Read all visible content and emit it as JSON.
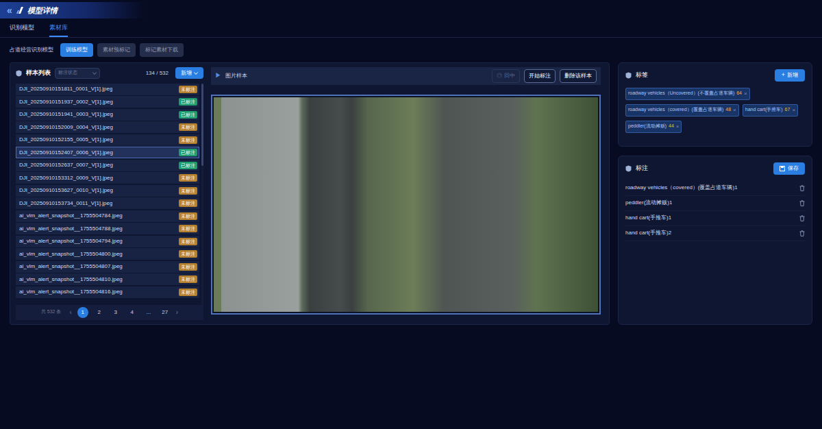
{
  "header": {
    "back_icon": "«",
    "title": "模型详情"
  },
  "tabs": [
    {
      "label": "识别模型",
      "selected": false
    },
    {
      "label": "素材库",
      "selected": true
    }
  ],
  "toolbar": {
    "model_name": "占道经营识别模型",
    "buttons": [
      {
        "label": "训练模型",
        "selected": true
      },
      {
        "label": "素材预标记",
        "selected": false
      },
      {
        "label": "标记素材下载",
        "selected": false
      }
    ]
  },
  "sample_list": {
    "title": "样本列表",
    "filter": {
      "placeholder": "标注状态"
    },
    "count": "134 / 532",
    "add_button": "新增",
    "rows": [
      {
        "name": "DJI_20250910151811_0001_V[1].jpeg",
        "status": "未标注",
        "labeled": false,
        "selected": false
      },
      {
        "name": "DJI_20250910151937_0002_V[1].jpeg",
        "status": "已标注",
        "labeled": true,
        "selected": false
      },
      {
        "name": "DJI_20250910151941_0003_V[1].jpeg",
        "status": "已标注",
        "labeled": true,
        "selected": false
      },
      {
        "name": "DJI_20250910152009_0004_V[1].jpeg",
        "status": "未标注",
        "labeled": false,
        "selected": false
      },
      {
        "name": "DJI_20250910152155_0005_V[1].jpeg",
        "status": "未标注",
        "labeled": false,
        "selected": false
      },
      {
        "name": "DJI_20250910152407_0006_V[1].jpeg",
        "status": "已标注",
        "labeled": true,
        "selected": true
      },
      {
        "name": "DJI_20250910152637_0007_V[1].jpeg",
        "status": "已标注",
        "labeled": true,
        "selected": false
      },
      {
        "name": "DJI_20250910153312_0009_V[1].jpeg",
        "status": "未标注",
        "labeled": false,
        "selected": false
      },
      {
        "name": "DJI_20250910153627_0010_V[1].jpeg",
        "status": "未标注",
        "labeled": false,
        "selected": false
      },
      {
        "name": "DJI_20250910153734_0011_V[1].jpeg",
        "status": "未标注",
        "labeled": false,
        "selected": false
      },
      {
        "name": "ai_vlm_alert_snapshot__1755504784.jpeg",
        "status": "未标注",
        "labeled": false,
        "selected": false
      },
      {
        "name": "ai_vlm_alert_snapshot__1755504788.jpeg",
        "status": "未标注",
        "labeled": false,
        "selected": false
      },
      {
        "name": "ai_vlm_alert_snapshot__1755504794.jpeg",
        "status": "未标注",
        "labeled": false,
        "selected": false
      },
      {
        "name": "ai_vlm_alert_snapshot__1755504800.jpeg",
        "status": "未标注",
        "labeled": false,
        "selected": false
      },
      {
        "name": "ai_vlm_alert_snapshot__1755504807.jpeg",
        "status": "未标注",
        "labeled": false,
        "selected": false
      },
      {
        "name": "ai_vlm_alert_snapshot__1755504810.jpeg",
        "status": "未标注",
        "labeled": false,
        "selected": false
      },
      {
        "name": "ai_vlm_alert_snapshot__1755504816.jpeg",
        "status": "未标注",
        "labeled": false,
        "selected": false
      }
    ],
    "pagination": {
      "total": "共 532 条",
      "prev": "‹",
      "next": "›",
      "pages": [
        {
          "label": "1",
          "selected": true
        },
        {
          "label": "2",
          "selected": false
        },
        {
          "label": "3",
          "selected": false
        },
        {
          "label": "4",
          "selected": false
        },
        {
          "label": "...",
          "selected": false
        },
        {
          "label": "27",
          "selected": false
        }
      ]
    }
  },
  "preview": {
    "icon": "▶",
    "title": "图片样本",
    "buttons": [
      {
        "icon": "◎",
        "label": "回中",
        "disabled": true
      },
      {
        "icon": "",
        "label": "开始标注",
        "disabled": false
      },
      {
        "icon": "",
        "label": "删除该样本",
        "disabled": false
      }
    ]
  },
  "labels_panel": {
    "title": "标签",
    "add_icon": "+",
    "add_button": "新增",
    "tags": [
      {
        "label": "roadway vehicles（Uncovered）(不覆盖占道车辆)",
        "count": "64",
        "close": "×"
      },
      {
        "label": "roadway vehicles（covered）(覆盖占道车辆)",
        "count": "48",
        "close": "×"
      },
      {
        "label": "hand cart(手推车)",
        "count": "67",
        "close": "×"
      },
      {
        "label": "peddler(流动摊贩)",
        "count": "44",
        "close": "×"
      }
    ]
  },
  "annotations_panel": {
    "title": "标注",
    "save_button": "保存",
    "items": [
      {
        "label": "roadway vehicles（covered）(覆盖占道车辆)1"
      },
      {
        "label": "peddler(流动摊贩)1"
      },
      {
        "label": "hand cart(手推车)1"
      },
      {
        "label": "hand cart(手推车)2"
      }
    ]
  }
}
